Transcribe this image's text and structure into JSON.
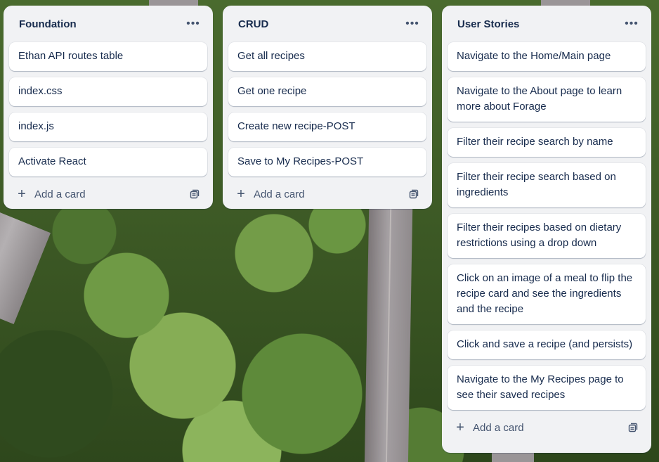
{
  "lists": [
    {
      "title": "Foundation",
      "cards": [
        "Ethan API routes table",
        "index.css",
        "index.js",
        "Activate React"
      ],
      "add_label": "Add a card"
    },
    {
      "title": "CRUD",
      "cards": [
        "Get all recipes",
        "Get one recipe",
        "Create new recipe-POST",
        "Save to My Recipes-POST"
      ],
      "add_label": "Add a card"
    },
    {
      "title": "User Stories",
      "cards": [
        "Navigate to the Home/Main page",
        "Navigate to the About page to learn more about Forage",
        "Filter their recipe search by name",
        "Filter their recipe search based on ingredients",
        "Filter their recipes based on dietary restrictions using a drop down",
        "Click on an image of a meal to flip the recipe card and see the ingredients and the recipe",
        "Click and save a recipe (and persists)",
        "Navigate to the My Recipes page to see their saved recipes"
      ],
      "add_label": "Add a card"
    }
  ],
  "icons": {
    "menu": "more-horizontal-icon",
    "add": "plus-icon",
    "template": "card-template-icon"
  },
  "colors": {
    "list_bg": "#f1f2f4",
    "card_bg": "#ffffff",
    "text": "#172b4d",
    "muted": "#44546f"
  }
}
